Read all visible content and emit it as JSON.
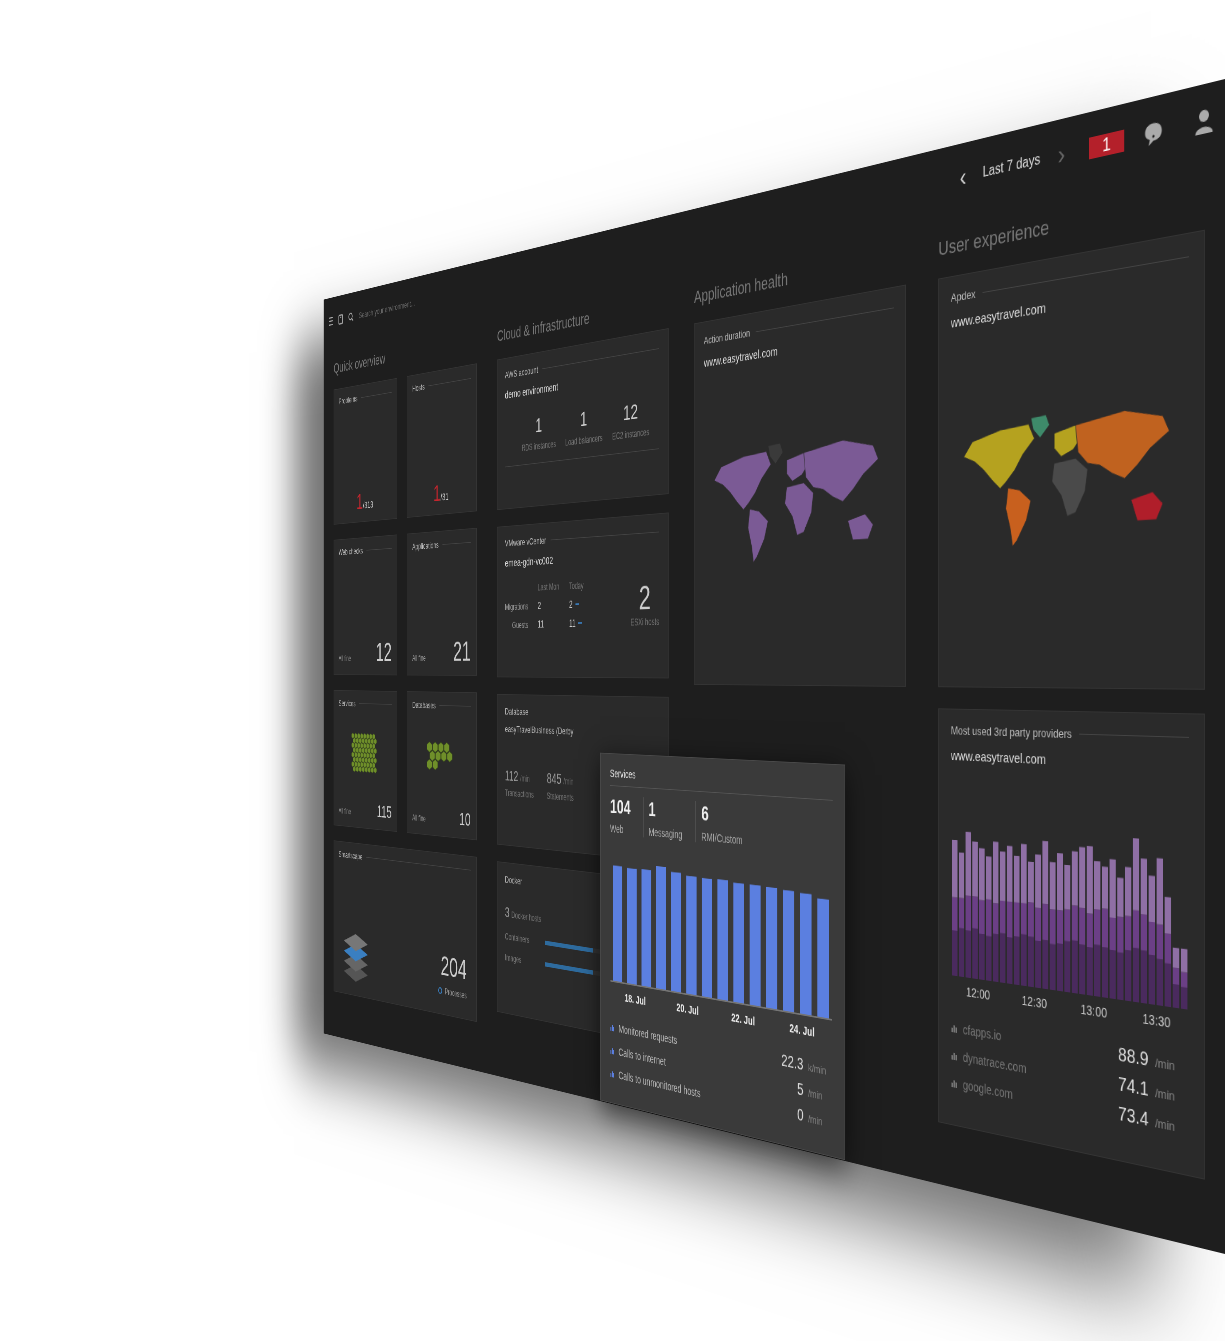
{
  "header": {
    "menu_icon": "☰",
    "search_placeholder": "Search your environment...",
    "prev": "‹",
    "timeframe": "Last 7 days",
    "next": "›",
    "problems_badge": "1"
  },
  "quick_overview": {
    "title": "Quick overview",
    "tiles": [
      {
        "kind": "ratio",
        "title": "Problems",
        "value": "1",
        "total": "/313"
      },
      {
        "kind": "ratio",
        "title": "Hosts",
        "value": "1",
        "total": "/31"
      },
      {
        "kind": "count",
        "title": "Web checks",
        "status": "All fine",
        "value": "12"
      },
      {
        "kind": "count",
        "title": "Applications",
        "status": "All fine",
        "value": "21"
      },
      {
        "kind": "hexes",
        "title": "Services",
        "status": "All fine",
        "value": "115"
      },
      {
        "kind": "hexes",
        "title": "Databases",
        "status": "All fine",
        "value": "10"
      },
      {
        "kind": "smartscape",
        "title": "Smartscape",
        "value": "204",
        "unit": "Processes"
      }
    ]
  },
  "cloud": {
    "title": "Cloud & infrastructure",
    "aws": {
      "title": "AWS account",
      "name": "demo environment",
      "stats": [
        {
          "value": "1",
          "label": "RDS instances"
        },
        {
          "value": "1",
          "label": "Load balancers"
        },
        {
          "value": "12",
          "label": "EC2 instances"
        }
      ]
    },
    "vmware": {
      "title": "VMware vCenter",
      "name": "emea-gdn-vc002",
      "columns": [
        "Last Mon",
        "Today"
      ],
      "rows": [
        {
          "label": "Migrations",
          "last": "2",
          "today": "2"
        },
        {
          "label": "Guests",
          "last": "11",
          "today": "11"
        }
      ],
      "hosts": "2",
      "hosts_label": "ESXi hosts"
    },
    "database": {
      "title": "Database",
      "name": "easyTravelBusiness (Derby",
      "stats": [
        {
          "value": "112",
          "unit": "/min",
          "label": "Transactions"
        },
        {
          "value": "845",
          "unit": "/min",
          "label": "Statements"
        }
      ]
    },
    "docker": {
      "title": "Docker",
      "hosts": "3",
      "hosts_label": "Docker hosts",
      "bars": [
        {
          "label": "Containers",
          "level": 0.6
        },
        {
          "label": "Images",
          "level": 0.6
        }
      ]
    }
  },
  "app_health": {
    "title": "Application health",
    "card": {
      "title": "Action duration",
      "subtitle": "www.easytravel.com"
    }
  },
  "user_experience": {
    "title": "User experience",
    "apdex": {
      "title": "Apdex",
      "subtitle": "www.easytravel.com",
      "region_colors": [
        "#b5a21f",
        "#3e8a6a",
        "#c8601e",
        "#b5a21f",
        "#4a4a4a",
        "#c0621f",
        "#b01e2a"
      ]
    },
    "providers": {
      "title": "Most used 3rd party providers",
      "subtitle": "www.easytravel.com",
      "series": [
        {
          "color": "#4a2a5e",
          "values": [
            30,
            32,
            31,
            33,
            30,
            29,
            31,
            32,
            30,
            31,
            33,
            32,
            30,
            31,
            29,
            30,
            32,
            33,
            31,
            30,
            32,
            31,
            30,
            29,
            31,
            33,
            32,
            30,
            28,
            26,
            14,
            13
          ]
        },
        {
          "color": "#6b3f86",
          "values": [
            22,
            20,
            23,
            21,
            22,
            24,
            20,
            21,
            23,
            22,
            20,
            22,
            21,
            23,
            22,
            21,
            20,
            22,
            23,
            21,
            22,
            24,
            20,
            22,
            21,
            23,
            22,
            20,
            21,
            18,
            10,
            9
          ]
        },
        {
          "color": "#8f6fa5",
          "values": [
            38,
            30,
            42,
            36,
            34,
            28,
            40,
            32,
            36,
            30,
            38,
            26,
            34,
            40,
            30,
            36,
            28,
            34,
            38,
            42,
            30,
            26,
            36,
            24,
            30,
            44,
            34,
            28,
            40,
            22,
            12,
            14
          ]
        }
      ],
      "ticks": [
        "12:00",
        "12:30",
        "13:00",
        "13:30"
      ],
      "legend": [
        {
          "name": "cfapps.io",
          "value": "88.9",
          "unit": "/min"
        },
        {
          "name": "dynatrace.com",
          "value": "74.1",
          "unit": "/min"
        },
        {
          "name": "google.com",
          "value": "73.4",
          "unit": "/min"
        }
      ]
    }
  },
  "services_popup": {
    "title": "Services",
    "counts": [
      {
        "value": "104",
        "label": "Web"
      },
      {
        "value": "1",
        "label": "Messaging"
      },
      {
        "value": "6",
        "label": "RMI/Custom"
      }
    ],
    "values": [
      22.6,
      22.4,
      22.5,
      23.4,
      22.6,
      22.2,
      22.1,
      22.2,
      21.9,
      21.9,
      21.8,
      21.6,
      21.4,
      20.8
    ],
    "ticks": [
      "18. Jul",
      "20. Jul",
      "22. Jul",
      "24. Jul"
    ],
    "legend": [
      {
        "label": "Monitored requests",
        "value": "22.3",
        "unit": "k/min"
      },
      {
        "label": "Calls to internet",
        "value": "5",
        "unit": "/min"
      },
      {
        "label": "Calls to unmonitored hosts",
        "value": "0",
        "unit": "/min"
      }
    ]
  }
}
